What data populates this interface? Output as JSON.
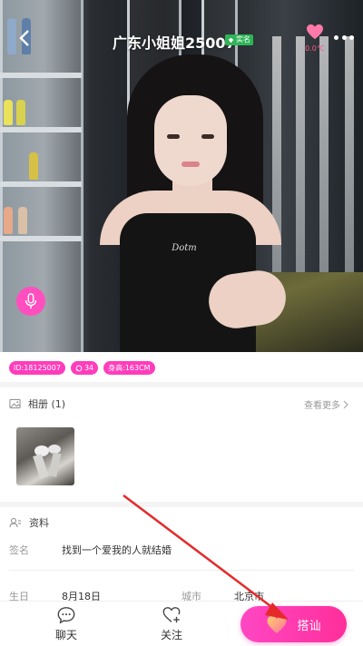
{
  "header": {
    "title": "广东小姐姐25007",
    "verified_label": "实名",
    "heat_value": "0.0℃"
  },
  "profile": {
    "tags": [
      {
        "text": "ID:18125007",
        "icon": ""
      },
      {
        "text": "34",
        "icon": "chat-bubble-icon"
      },
      {
        "text": "身高:163CM",
        "icon": ""
      }
    ]
  },
  "album": {
    "title": "相册 (1)",
    "see_more": "查看更多"
  },
  "info": {
    "title": "资料",
    "signature_label": "签名",
    "signature_value": "找到一个爱我的人就结婚",
    "birthday_label": "生日",
    "birthday_value": "8月18日",
    "city_label": "城市",
    "city_value": "北京市"
  },
  "bottom": {
    "chat_label": "聊天",
    "follow_label": "关注",
    "cta_label": "搭讪"
  },
  "colors": {
    "accent": "#ff3dbb",
    "verified": "#2fb457",
    "annotation_arrow": "#e52a2a"
  }
}
